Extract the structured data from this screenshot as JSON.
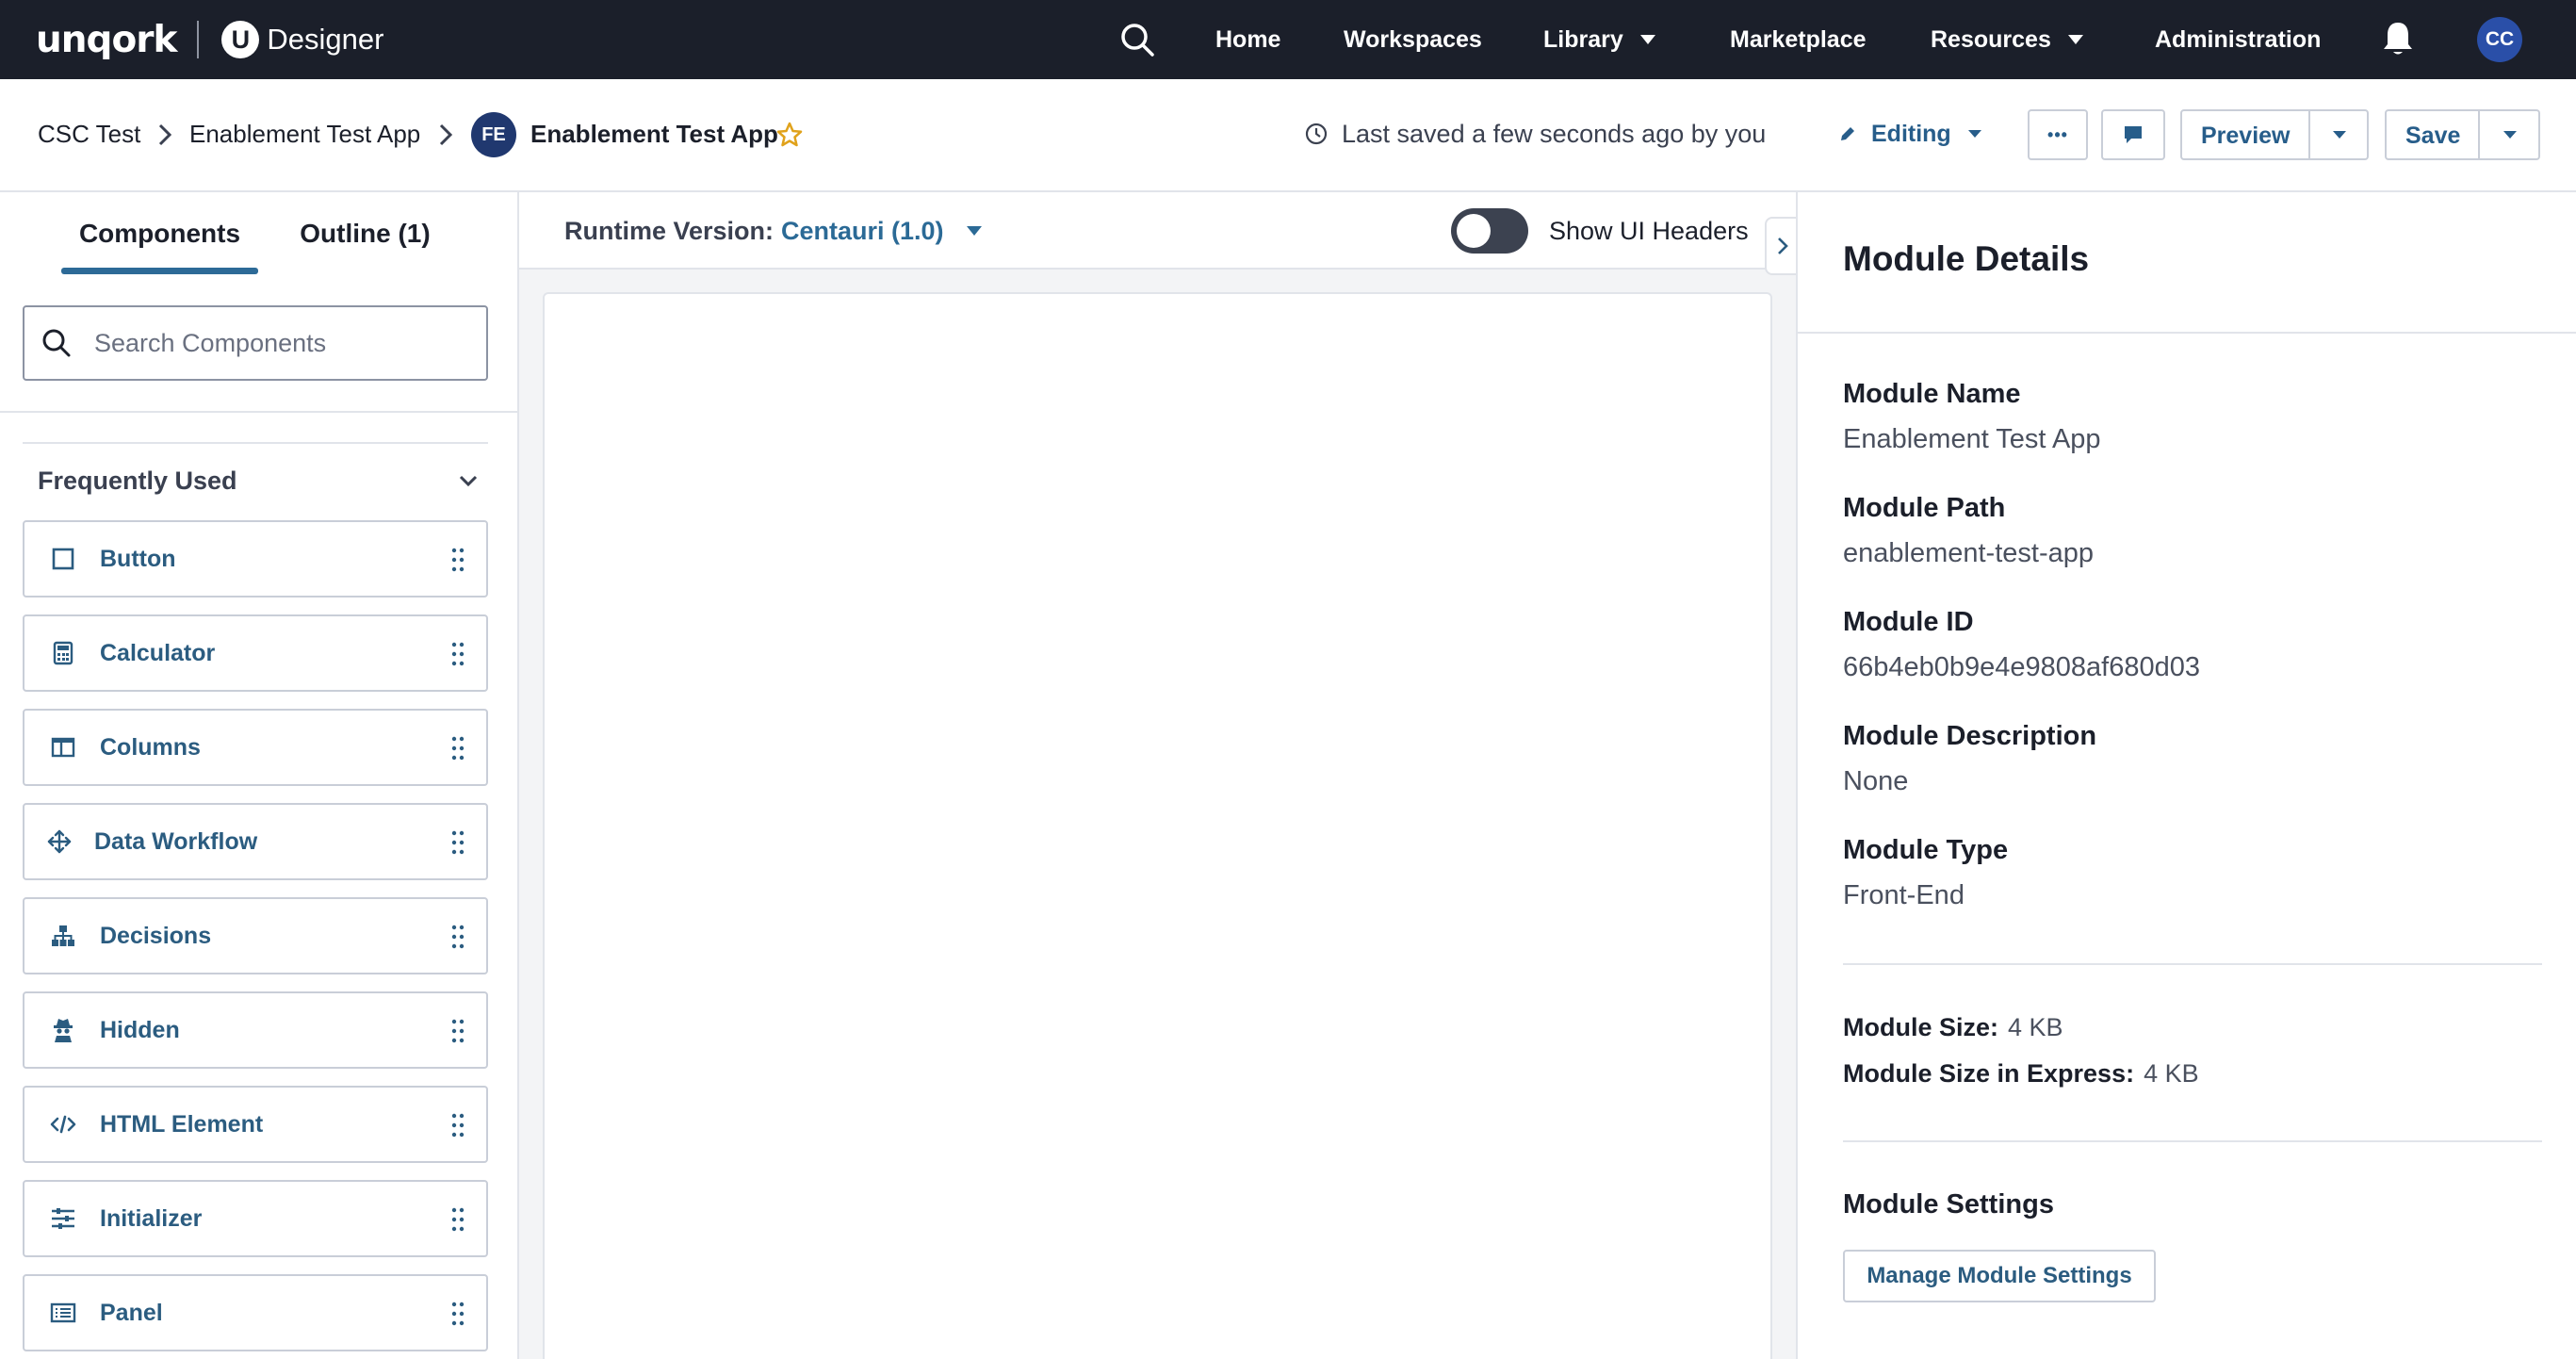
{
  "topnav": {
    "brand": "unqork",
    "brand_badge": "U",
    "product": "Designer",
    "items": [
      "Home",
      "Workspaces",
      "Library",
      "Marketplace",
      "Resources",
      "Administration"
    ],
    "user_initials": "CC"
  },
  "header": {
    "breadcrumbs": [
      "CSC Test",
      "Enablement Test App"
    ],
    "module_badge": "FE",
    "module_title": "Enablement Test App",
    "saved_status": "Last saved a few seconds ago by you",
    "mode": "Editing",
    "more_label": "•••",
    "preview_label": "Preview",
    "save_label": "Save"
  },
  "left_panel": {
    "tabs": [
      "Components",
      "Outline (1)"
    ],
    "active_tab": "Components",
    "search_placeholder": "Search Components",
    "section_title": "Frequently Used",
    "components": [
      {
        "label": "Button",
        "icon": "square-icon"
      },
      {
        "label": "Calculator",
        "icon": "calculator-icon"
      },
      {
        "label": "Columns",
        "icon": "columns-icon"
      },
      {
        "label": "Data Workflow",
        "icon": "move-arrows-icon"
      },
      {
        "label": "Decisions",
        "icon": "hierarchy-icon"
      },
      {
        "label": "Hidden",
        "icon": "spy-icon"
      },
      {
        "label": "HTML Element",
        "icon": "code-icon"
      },
      {
        "label": "Initializer",
        "icon": "sliders-icon"
      },
      {
        "label": "Panel",
        "icon": "panel-icon"
      }
    ]
  },
  "canvas": {
    "runtime_label": "Runtime Version:",
    "runtime_value": "Centauri (1.0)",
    "toggle_label": "Show UI Headers",
    "toggle_on": false
  },
  "module_details": {
    "title": "Module Details",
    "fields": [
      {
        "label": "Module Name",
        "value": "Enablement Test App"
      },
      {
        "label": "Module Path",
        "value": "enablement-test-app"
      },
      {
        "label": "Module ID",
        "value": "66b4eb0b9e4e9808af680d03"
      },
      {
        "label": "Module Description",
        "value": "None"
      },
      {
        "label": "Module Type",
        "value": "Front-End"
      }
    ],
    "size_label": "Module Size:",
    "size_value": "4 KB",
    "express_size_label": "Module Size in Express:",
    "express_size_value": "4 KB",
    "settings_title": "Module Settings",
    "settings_button": "Manage Module Settings"
  },
  "colors": {
    "nav_bg": "#1b1f2a",
    "accent": "#2b6a96",
    "badge": "#20386f",
    "star": "#e0a21b"
  }
}
